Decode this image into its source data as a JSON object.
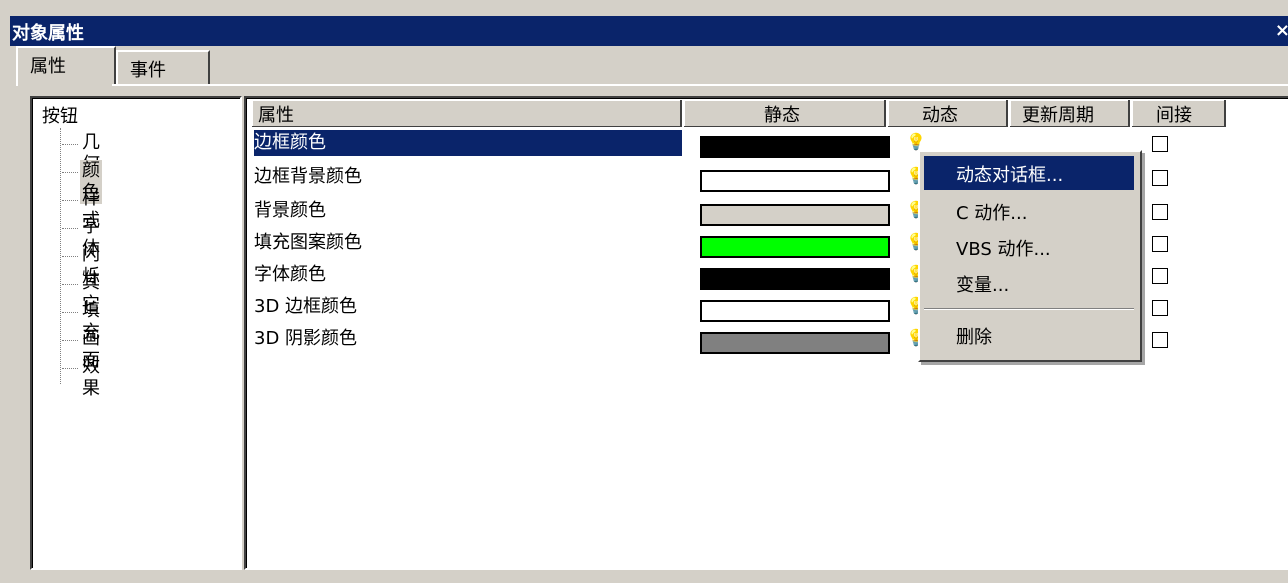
{
  "window": {
    "title": "对象属性",
    "close": "×"
  },
  "tabs": [
    {
      "label": "属性"
    },
    {
      "label": "事件"
    }
  ],
  "tree": {
    "root": "按钮",
    "children": [
      "几何",
      "颜色",
      "样式",
      "字体",
      "闪烁",
      "其它",
      "填充",
      "画面",
      "效果"
    ],
    "selected_index": 1
  },
  "table": {
    "columns": [
      "属性",
      "静态",
      "动态",
      "更新周期",
      "间接"
    ],
    "rows": [
      {
        "name": "边框颜色",
        "static_color": "#000000"
      },
      {
        "name": "边框背景颜色",
        "static_color": "#ffffff"
      },
      {
        "name": "背景颜色",
        "static_color": "#d4d0c8"
      },
      {
        "name": "填充图案颜色",
        "static_color": "#00ff00"
      },
      {
        "name": "字体颜色",
        "static_color": "#000000"
      },
      {
        "name": "3D 边框颜色",
        "static_color": "#ffffff"
      },
      {
        "name": "3D 阴影颜色",
        "static_color": "#808080"
      }
    ],
    "selected_row": 0,
    "dynamic_icon": "lightbulb-icon"
  },
  "context_menu": {
    "items": [
      "动态对话框...",
      "C 动作...",
      "VBS 动作...",
      "变量...",
      "删除"
    ],
    "highlighted": 0
  }
}
